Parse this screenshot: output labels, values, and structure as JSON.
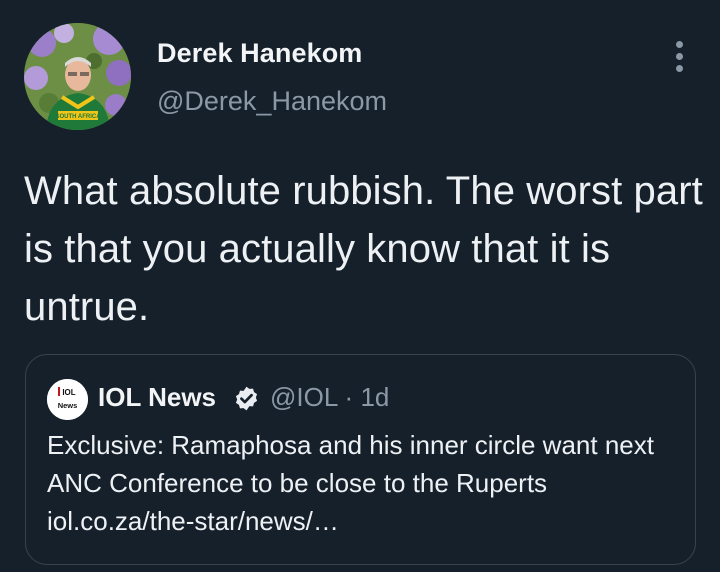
{
  "author": {
    "display_name": "Derek Hanekom",
    "handle": "@Derek_Hanekom",
    "avatar_icon": "profile-photo",
    "shirt_text": "SOUTH AFRICA"
  },
  "more_icon": "more-vertical-icon",
  "tweet": {
    "text": "What absolute rubbish. The worst part is that you actually know that it is untrue."
  },
  "quote": {
    "display_name": "IOL News",
    "meta": "@IOL · 1d",
    "verified_icon": "verified-badge-icon",
    "avatar_logo_top": "IOL",
    "avatar_logo_bottom": "News",
    "text": "Exclusive: Ramaphosa and his inner circle want next ANC Conference to be close to the Ruperts iol.co.za/the-star/news/…"
  },
  "colors": {
    "background": "#16202b",
    "primary_text": "#eef1f4",
    "secondary_text": "#8b98a5",
    "border": "#38444d"
  }
}
